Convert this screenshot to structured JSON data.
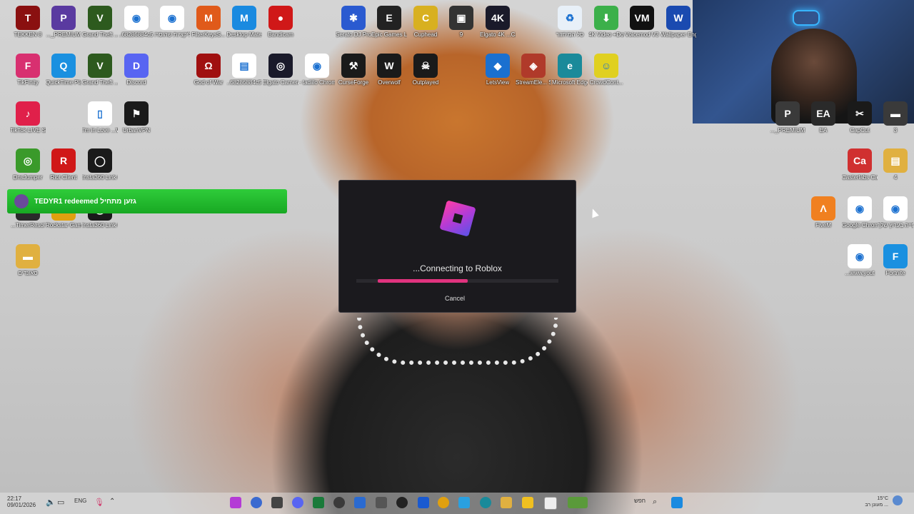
{
  "desktop": {
    "icons": [
      {
        "label": "TEKKEN 8",
        "glyph": "T",
        "color": "#8a1010"
      },
      {
        "label": "..._PREMIUM",
        "glyph": "P",
        "color": "#5a3aa0"
      },
      {
        "label": "Grand Theft ...Auto V En",
        "glyph": "V",
        "color": "#2d5a1e"
      },
      {
        "label": "..68286884c5 ...עותק",
        "glyph": "◉",
        "color": "#ffffff"
      },
      {
        "label": "אפליקציות שהוסרו",
        "glyph": "◉",
        "color": "#ffffff"
      },
      {
        "label": "FilterKeysS...",
        "glyph": "M",
        "color": "#e05a1a"
      },
      {
        "label": "Desktop Mate",
        "glyph": "M",
        "color": "#1a8ae0"
      },
      {
        "label": "Bandicam",
        "glyph": "●",
        "color": "#d01818"
      },
      {
        "label": "Serato DJ Pro",
        "glyph": "✱",
        "color": "#2a5ad0"
      },
      {
        "label": "Epic Games Launcher",
        "glyph": "E",
        "color": "#222222"
      },
      {
        "label": "Cuphead",
        "glyph": "C",
        "color": "#d8b020"
      },
      {
        "label": "9",
        "glyph": "▣",
        "color": "#333333"
      },
      {
        "label": "Elgato 4K ...Captur",
        "glyph": "4K",
        "color": "#1a1a2a"
      },
      {
        "label": "סל המיחזור",
        "glyph": "♻",
        "color": "#e8f0f8"
      },
      {
        "label": "4K Video +Downloader",
        "glyph": "⬇",
        "color": "#3cb04a"
      },
      {
        "label": "Voicemod V3",
        "glyph": "VM",
        "color": "#111111"
      },
      {
        "label": "Wallpaper Engine",
        "glyph": "W",
        "color": "#1a4ab0"
      },
      {
        "label": "TikFinity",
        "glyph": "F",
        "color": "#d83070"
      },
      {
        "label": "QuickTime Player",
        "glyph": "Q",
        "color": "#1a90e0"
      },
      {
        "label": "Grand Theft ...Auto V Le",
        "glyph": "V",
        "color": "#2d5a1e"
      },
      {
        "label": "Discord",
        "glyph": "D",
        "color": "#5865f2"
      },
      {
        "label": "God of War",
        "glyph": "Ω",
        "color": "#a01010"
      },
      {
        "label": "..68286884c5",
        "glyph": "▤",
        "color": "#ffffff"
      },
      {
        "label": "Elgato Camera Hub",
        "glyph": "◎",
        "color": "#1a1a2a"
      },
      {
        "label": "- tadiilo Chrome",
        "glyph": "◉",
        "color": "#ffffff"
      },
      {
        "label": "CurseForge",
        "glyph": "⚒",
        "color": "#1a1a1a"
      },
      {
        "label": "Overwolf",
        "glyph": "W",
        "color": "#1a1a1a"
      },
      {
        "label": "Outplayed",
        "glyph": "☠",
        "color": "#1a1a1a"
      },
      {
        "label": "LetsView",
        "glyph": "◆",
        "color": "#1a70d0"
      },
      {
        "label": "StreamEle... SE.Live",
        "glyph": "◈",
        "color": "#b03a2a"
      },
      {
        "label": "Microsoft Edge",
        "glyph": "e",
        "color": "#1a8a9a"
      },
      {
        "label": "CrowdCont...",
        "glyph": "☺",
        "color": "#e0d020"
      },
      {
        "label": "TikTok LIVE Studio",
        "glyph": "♪",
        "color": "#e0204a"
      },
      {
        "label": "I'm in Love ...With Your",
        "glyph": "▯",
        "color": "#ffffff"
      },
      {
        "label": "UrbanVPN",
        "glyph": "⚑",
        "color": "#1a1a1a"
      },
      {
        "label": "DnsJumper",
        "glyph": "◎",
        "color": "#3a9a2a"
      },
      {
        "label": "Riot Client",
        "glyph": "R",
        "color": "#d01818"
      },
      {
        "label": "Insta360 Link Controller",
        "glyph": "◯",
        "color": "#1a1a1a"
      },
      {
        "label": "...TimerResol",
        "glyph": "⏱",
        "color": "#2a2a2a"
      },
      {
        "label": "Rockstar Games",
        "glyph": "R",
        "color": "#e0a010"
      },
      {
        "label": "Insta360 Link Controller",
        "glyph": "◯",
        "color": "#1a1a1a"
      },
      {
        "label": "סאונדים",
        "glyph": "▬",
        "color": "#e0b040"
      },
      {
        "label": "..._PREMIUM",
        "glyph": "P",
        "color": "#3a3a3a"
      },
      {
        "label": "EA",
        "glyph": "EA",
        "color": "#2a2a2a"
      },
      {
        "label": "CapCut",
        "glyph": "✂",
        "color": "#1a1a1a"
      },
      {
        "label": "3",
        "glyph": "▬",
        "color": "#3a3a3a"
      },
      {
        "label": "Casterlabs Caffeinated",
        "glyph": "Ca",
        "color": "#d03030"
      },
      {
        "label": "4",
        "glyph": "▤",
        "color": "#e0b040"
      },
      {
        "label": "FiveM",
        "glyph": "Λ",
        "color": "#f08020"
      },
      {
        "label": "Google Chrome",
        "glyph": "◉",
        "color": "#ffffff"
      },
      {
        "label": "לצפייה בערוץ שלך",
        "glyph": "◉",
        "color": "#ffffff"
      },
      {
        "label": "...www.yout",
        "glyph": "◉",
        "color": "#ffffff"
      },
      {
        "label": "Fortnite",
        "glyph": "F",
        "color": "#1a90e0"
      }
    ]
  },
  "notification": {
    "text": "TEDYR1 redeemed גזען מתחיל"
  },
  "dialog": {
    "status_text": "...Connecting to Roblox",
    "progress_percent": 47,
    "cancel_label": "Cancel",
    "accent_color": "#e0337e"
  },
  "taskbar": {
    "time": "22:17",
    "date": "09/01/2026",
    "language": "ENG",
    "search_placeholder": "חפש",
    "weather_text": "15°C",
    "weather_sub": "מעונן רב ..."
  }
}
